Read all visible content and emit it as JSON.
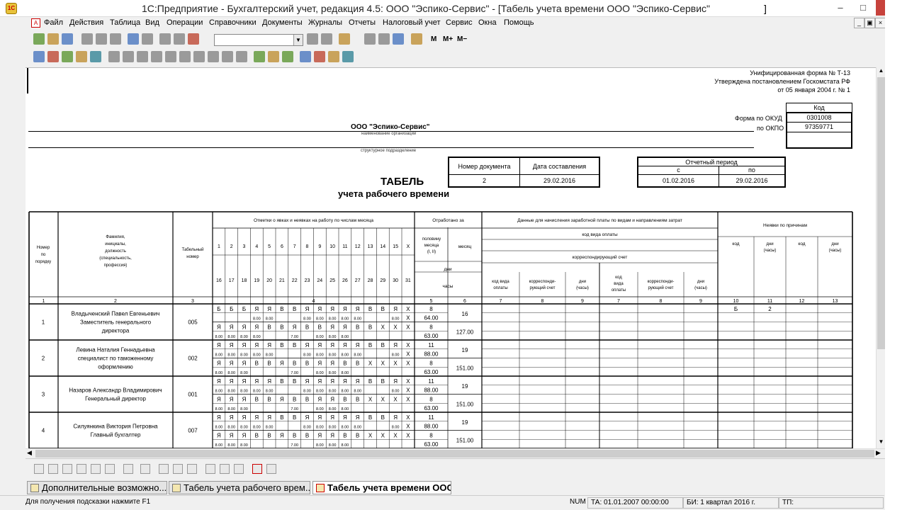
{
  "window": {
    "title": "1С:Предприятие - Бухгалтерский учет, редакция 4.5: ООО \"Эспико-Сервис\" - [Табель учета времени ООО \"Эспико-Сервис\"",
    "title_tail": "]"
  },
  "menu": [
    "Файл",
    "Действия",
    "Таблица",
    "Вид",
    "Операции",
    "Справочники",
    "Документы",
    "Журналы",
    "Отчеты",
    "Налоговый учет",
    "Сервис",
    "Окна",
    "Помощь"
  ],
  "toolbar": {
    "search_value": "",
    "m_labels": [
      "M",
      "M+",
      "M−"
    ]
  },
  "form": {
    "header_lines": [
      "Унифицированная форма № Т-13",
      "Утверждена постановлением Госкомстата РФ",
      "от 05 января 2004 г. № 1"
    ],
    "code_label": "Код",
    "okud_label": "Форма по ОКУД",
    "okud_value": "0301008",
    "okpo_label": "по ОКПО",
    "okpo_value": "97359771",
    "org_name": "ООО \"Эспико-Сервис\"",
    "org_caption": "наименование организации",
    "division_caption": "структурное подразделение",
    "doc_number_label": "Номер документа",
    "doc_date_label": "Дата составления",
    "doc_number": "2",
    "doc_date": "29.02.2016",
    "period_label": "Отчетный период",
    "period_from_label": "с",
    "period_to_label": "по",
    "period_from": "01.02.2016",
    "period_to": "29.02.2016",
    "title": "ТАБЕЛЬ",
    "subtitle": "учета рабочего времени"
  },
  "table": {
    "h_num": "Номер по порядку",
    "h_name": "Фамилия, инициалы, должность (специальность, профессия)",
    "h_tab": "Табельный номер",
    "h_marks": "Отметки о явках и неявках на работу по числам месяца",
    "h_worked": "Отработано за",
    "h_half": "половину месяца (I, II)",
    "h_month": "месяц",
    "h_days": "дни",
    "h_hours": "часы",
    "h_salary": "Данные для начисления заработной платы по видам и направлениям затрат",
    "h_paycode": "код вида оплаты",
    "h_corr": "корреспондирующий счет",
    "h_paycode2": "код вида оплаты",
    "h_corr2": "корреспонди- рующий счет",
    "h_dayshours": "дни (часы)",
    "h_absence": "Неявки по причинам",
    "h_code": "код",
    "days_top": [
      "1",
      "2",
      "3",
      "4",
      "5",
      "6",
      "7",
      "8",
      "9",
      "10",
      "11",
      "12",
      "13",
      "14",
      "15",
      "X"
    ],
    "days_bottom": [
      "16",
      "17",
      "18",
      "19",
      "20",
      "21",
      "22",
      "23",
      "24",
      "25",
      "26",
      "27",
      "28",
      "29",
      "30",
      "31"
    ],
    "col_numbers": [
      "1",
      "2",
      "3",
      "4",
      "5",
      "6",
      "7",
      "8",
      "9",
      "7",
      "8",
      "9",
      "10",
      "11",
      "12",
      "13"
    ],
    "rows": [
      {
        "num": "1",
        "name": [
          "Владыченский Павел Евгеньевич",
          "Заместитель генерального",
          "директора"
        ],
        "tab": "005",
        "m1": [
          "Б",
          "Б",
          "Б",
          "Я",
          "Я",
          "В",
          "В",
          "Я",
          "Я",
          "Я",
          "Я",
          "Я",
          "В",
          "В",
          "Я",
          "X"
        ],
        "h1": [
          "",
          "",
          "",
          "8.00",
          "8.00",
          "",
          "",
          "8.00",
          "8.00",
          "8.00",
          "8.00",
          "8.00",
          "",
          "",
          "8.00",
          "X"
        ],
        "m2": [
          "Я",
          "Я",
          "Я",
          "Я",
          "В",
          "В",
          "Я",
          "В",
          "В",
          "Я",
          "Я",
          "В",
          "В",
          "X",
          "X",
          "X"
        ],
        "h2": [
          "8.00",
          "8.00",
          "8.00",
          "8.00",
          "",
          "",
          "7.00",
          "",
          "8.00",
          "8.00",
          "8.00",
          "",
          "",
          "",
          "",
          ""
        ],
        "d1": "8",
        "hh1": "64.00",
        "d2": "8",
        "hh2": "63.00",
        "mdays": "16",
        "mhours": "127.00",
        "abs_code": "Б",
        "abs_days": "2"
      },
      {
        "num": "2",
        "name": [
          "Левина Наталия Геннадьевна",
          "специалист по таможенному",
          "оформлению"
        ],
        "tab": "002",
        "m1": [
          "Я",
          "Я",
          "Я",
          "Я",
          "Я",
          "В",
          "В",
          "Я",
          "Я",
          "Я",
          "Я",
          "Я",
          "В",
          "В",
          "Я",
          "X"
        ],
        "h1": [
          "8.00",
          "8.00",
          "8.00",
          "8.00",
          "8.00",
          "",
          "",
          "8.00",
          "8.00",
          "8.00",
          "8.00",
          "8.00",
          "",
          "",
          "8.00",
          "X"
        ],
        "m2": [
          "Я",
          "Я",
          "Я",
          "В",
          "В",
          "Я",
          "В",
          "В",
          "Я",
          "Я",
          "В",
          "В",
          "X",
          "X",
          "X",
          "X"
        ],
        "h2": [
          "8.00",
          "8.00",
          "8.00",
          "",
          "",
          "",
          "7.00",
          "",
          "8.00",
          "8.00",
          "8.00",
          "",
          "",
          "",
          "",
          ""
        ],
        "d1": "11",
        "hh1": "88.00",
        "d2": "8",
        "hh2": "63.00",
        "mdays": "19",
        "mhours": "151.00",
        "abs_code": "",
        "abs_days": ""
      },
      {
        "num": "3",
        "name": [
          "Назаров Александр Владимирович",
          "Генеральный директор"
        ],
        "tab": "001",
        "m1": [
          "Я",
          "Я",
          "Я",
          "Я",
          "Я",
          "В",
          "В",
          "Я",
          "Я",
          "Я",
          "Я",
          "Я",
          "В",
          "В",
          "Я",
          "X"
        ],
        "h1": [
          "8.00",
          "8.00",
          "8.00",
          "8.00",
          "8.00",
          "",
          "",
          "8.00",
          "8.00",
          "8.00",
          "8.00",
          "8.00",
          "",
          "",
          "8.00",
          "X"
        ],
        "m2": [
          "Я",
          "Я",
          "Я",
          "В",
          "В",
          "Я",
          "В",
          "В",
          "Я",
          "Я",
          "В",
          "В",
          "X",
          "X",
          "X",
          "X"
        ],
        "h2": [
          "8.00",
          "8.00",
          "8.00",
          "",
          "",
          "",
          "7.00",
          "",
          "8.00",
          "8.00",
          "8.00",
          "",
          "",
          "",
          "",
          ""
        ],
        "d1": "11",
        "hh1": "88.00",
        "d2": "8",
        "hh2": "63.00",
        "mdays": "19",
        "mhours": "151.00",
        "abs_code": "",
        "abs_days": ""
      },
      {
        "num": "4",
        "name": [
          "Силуянкина Виктория Петровна",
          "Главный бухгалтер"
        ],
        "tab": "007",
        "m1": [
          "Я",
          "Я",
          "Я",
          "Я",
          "Я",
          "В",
          "В",
          "Я",
          "Я",
          "Я",
          "Я",
          "Я",
          "В",
          "В",
          "Я",
          "X"
        ],
        "h1": [
          "8.00",
          "8.00",
          "8.00",
          "8.00",
          "8.00",
          "",
          "",
          "8.00",
          "8.00",
          "8.00",
          "8.00",
          "8.00",
          "",
          "",
          "8.00",
          "X"
        ],
        "m2": [
          "Я",
          "Я",
          "Я",
          "В",
          "В",
          "Я",
          "В",
          "В",
          "Я",
          "Я",
          "В",
          "В",
          "X",
          "X",
          "X",
          "X"
        ],
        "h2": [
          "8.00",
          "8.00",
          "8.00",
          "",
          "",
          "",
          "7.00",
          "",
          "8.00",
          "8.00",
          "8.00",
          "",
          "",
          "",
          "",
          ""
        ],
        "d1": "11",
        "hh1": "88.00",
        "d2": "8",
        "hh2": "63.00",
        "mdays": "19",
        "mhours": "151.00",
        "abs_code": "",
        "abs_days": ""
      }
    ]
  },
  "tabs": [
    "Дополнительные возможно...",
    "Табель учета рабочего врем...",
    "Табель учета времени ООО..."
  ],
  "status": {
    "hint": "Для получения подсказки нажмите F1",
    "num": "NUM",
    "ta": "ТА: 01.01.2007  00:00:00",
    "bi": "БИ: 1 квартал 2016 г.",
    "tp": "ТП:"
  }
}
